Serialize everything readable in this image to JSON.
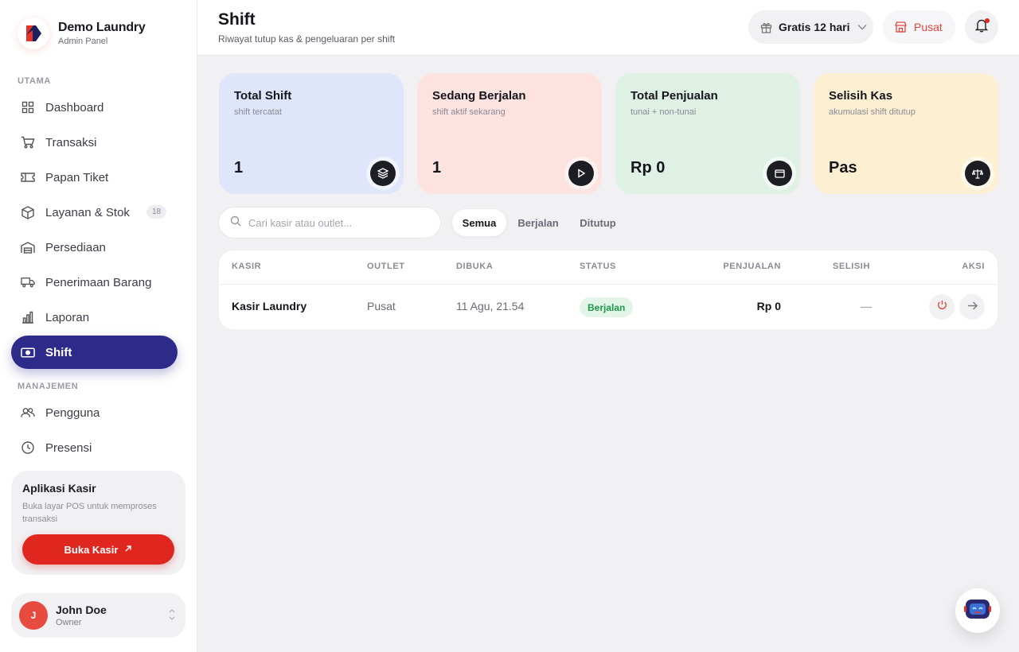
{
  "brand": {
    "name": "Demo Laundry",
    "subtitle": "Admin Panel"
  },
  "sidebar": {
    "section_main": "UTAMA",
    "section_manage": "MANAJEMEN",
    "items": [
      {
        "label": "Dashboard",
        "icon": "grid-icon"
      },
      {
        "label": "Transaksi",
        "icon": "cart-icon"
      },
      {
        "label": "Papan Tiket",
        "icon": "ticket-icon"
      },
      {
        "label": "Layanan & Stok",
        "icon": "box-icon",
        "badge": "18"
      },
      {
        "label": "Persediaan",
        "icon": "warehouse-icon"
      },
      {
        "label": "Penerimaan Barang",
        "icon": "truck-icon"
      },
      {
        "label": "Laporan",
        "icon": "bar-chart-icon"
      },
      {
        "label": "Shift",
        "icon": "cash-icon",
        "active": true
      },
      {
        "label": "Pengguna",
        "icon": "users-icon"
      },
      {
        "label": "Presensi",
        "icon": "clock-icon"
      }
    ],
    "kasir_card": {
      "title": "Aplikasi Kasir",
      "desc": "Buka layar POS untuk memproses transaksi",
      "button": "Buka Kasir"
    },
    "user": {
      "initial": "J",
      "name": "John Doe",
      "role": "Owner"
    }
  },
  "header": {
    "title": "Shift",
    "subtitle": "Riwayat tutup kas & pengeluaran per shift",
    "trial_label": "Gratis 12 hari",
    "outlet_label": "Pusat"
  },
  "stats": [
    {
      "title": "Total Shift",
      "sub": "shift tercatat",
      "value": "1",
      "bg": "#dfe5fb",
      "icon": "layers-icon"
    },
    {
      "title": "Sedang Berjalan",
      "sub": "shift aktif sekarang",
      "value": "1",
      "bg": "#fde3df",
      "icon": "play-icon"
    },
    {
      "title": "Total Penjualan",
      "sub": "tunai + non-tunai",
      "value": "Rp 0",
      "bg": "#def1e4",
      "icon": "wallet-icon"
    },
    {
      "title": "Selisih Kas",
      "sub": "akumulasi shift ditutup",
      "value": "Pas",
      "bg": "#fcefd2",
      "icon": "scale-icon"
    }
  ],
  "search": {
    "placeholder": "Cari kasir atau outlet..."
  },
  "filters": [
    {
      "label": "Semua",
      "active": true
    },
    {
      "label": "Berjalan",
      "active": false
    },
    {
      "label": "Ditutup",
      "active": false
    }
  ],
  "table": {
    "columns": [
      "KASIR",
      "OUTLET",
      "DIBUKA",
      "STATUS",
      "PENJUALAN",
      "SELISIH",
      "AKSI"
    ],
    "rows": [
      {
        "kasir": "Kasir Laundry",
        "outlet": "Pusat",
        "dibuka": "11 Agu, 21.54",
        "status": "Berjalan",
        "penjualan": "Rp 0",
        "selisih": "—"
      }
    ]
  },
  "colors": {
    "accent": "#2e2a8a",
    "danger": "#e0271f",
    "success": "#1f9a4a"
  }
}
